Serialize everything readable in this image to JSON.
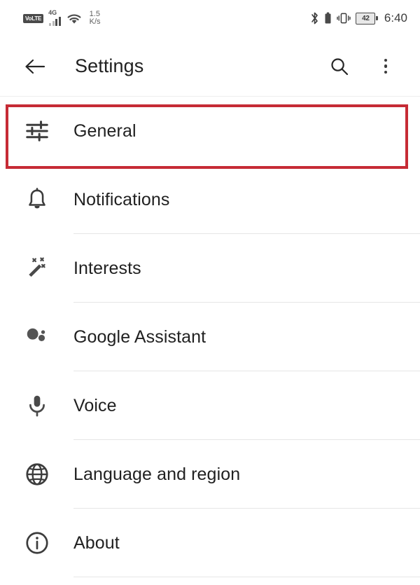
{
  "status_bar": {
    "volte_label": "VoLTE",
    "network_type": "4G",
    "signal_bars": 4,
    "wifi_icon": "wifi-icon",
    "data_speed_value": "1.5",
    "data_speed_unit": "K/s",
    "bluetooth_icon": "bluetooth-icon",
    "bluetooth_battery_icon": "bluetooth-battery-icon",
    "vibrate_icon": "vibrate-mode-icon",
    "battery_percent": "42",
    "time": "6:40"
  },
  "app_bar": {
    "back_icon": "back-arrow-icon",
    "title": "Settings",
    "search_icon": "search-icon",
    "overflow_icon": "overflow-menu-icon"
  },
  "highlight": {
    "color": "#C62B35",
    "target": "General"
  },
  "settings": {
    "items": [
      {
        "label": "General",
        "icon": "tune-sliders-icon",
        "highlighted": true
      },
      {
        "label": "Notifications",
        "icon": "bell-icon",
        "highlighted": false
      },
      {
        "label": "Interests",
        "icon": "magic-wand-icon",
        "highlighted": false
      },
      {
        "label": "Google Assistant",
        "icon": "google-assistant-icon",
        "highlighted": false
      },
      {
        "label": "Voice",
        "icon": "microphone-icon",
        "highlighted": false
      },
      {
        "label": "Language and region",
        "icon": "globe-icon",
        "highlighted": false
      },
      {
        "label": "About",
        "icon": "info-circle-icon",
        "highlighted": false
      }
    ]
  }
}
